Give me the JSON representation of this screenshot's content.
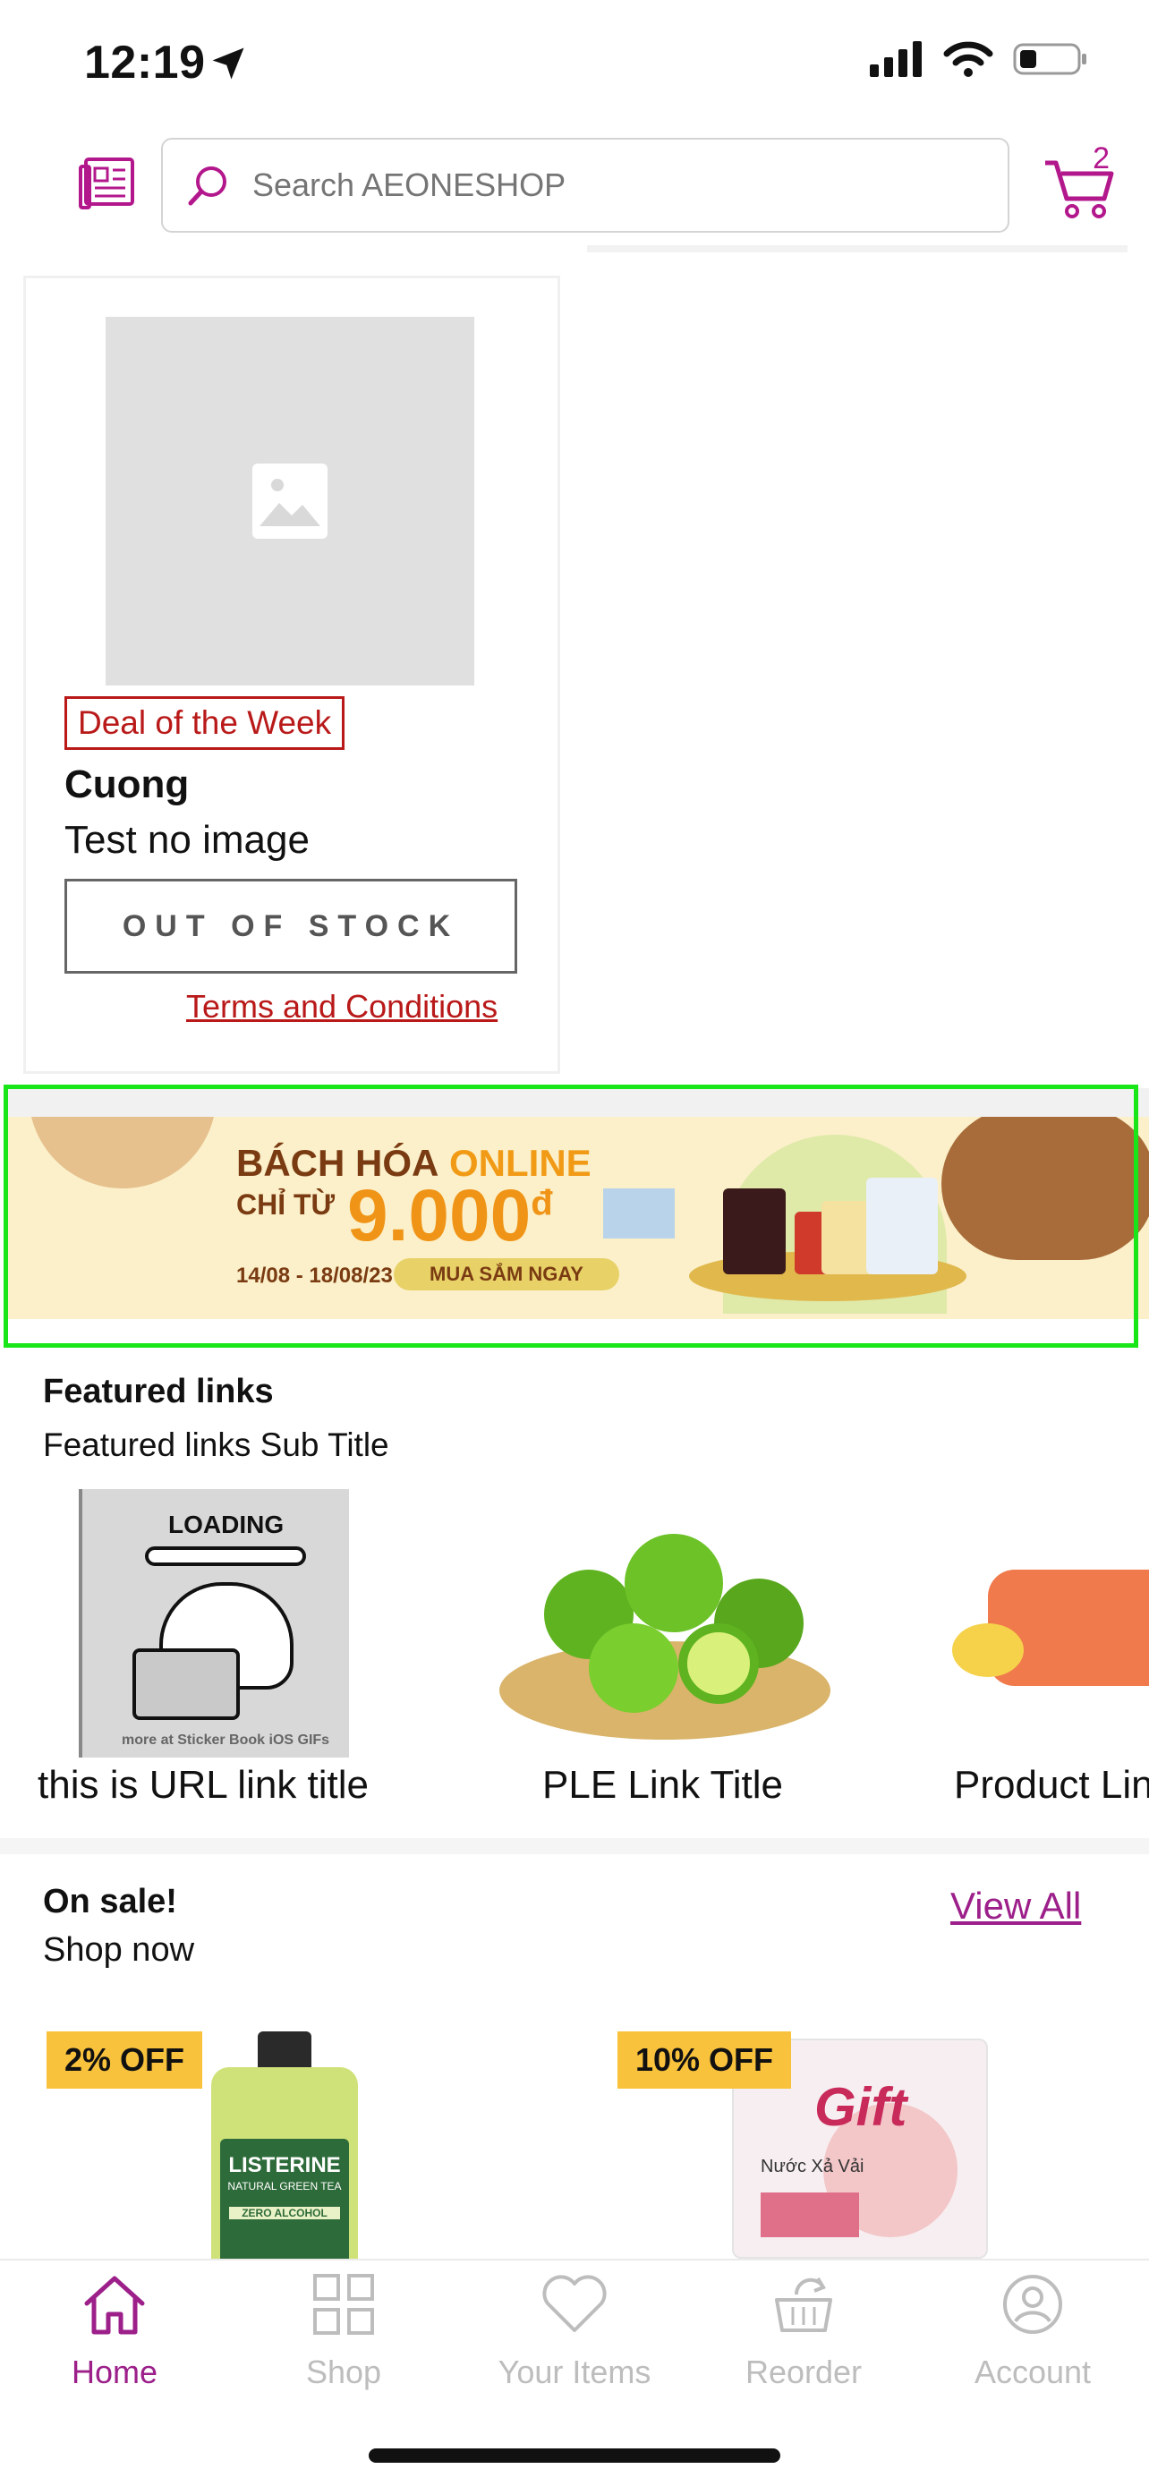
{
  "status_bar": {
    "time": "12:19"
  },
  "header": {
    "search_placeholder": "Search AEONESHOP",
    "cart_count": "2"
  },
  "deal": {
    "tag": "Deal of the Week",
    "brand": "Cuong",
    "name": "Test no image",
    "button": "OUT OF STOCK",
    "terms": "Terms and Conditions"
  },
  "banner": {
    "line1_a": "BÁCH HÓA",
    "line1_b": "ONLINE",
    "line2": "CHỈ TỪ",
    "price": "9.000",
    "currency": "đ",
    "dates": "14/08 - 18/08/23",
    "cta": "MUA SẮM NGAY"
  },
  "featured": {
    "title": "Featured links",
    "subtitle": "Featured links Sub Title",
    "items": [
      {
        "label": "this is URL link title",
        "loading": "LOADING",
        "credit": "more at Sticker Book iOS GIFs"
      },
      {
        "label": "PLE Link Title"
      },
      {
        "label": "Product Lin"
      }
    ]
  },
  "on_sale": {
    "title": "On sale!",
    "subtitle": "Shop now",
    "view_all": "View All",
    "products": [
      {
        "badge": "2% OFF",
        "brand_text": "LISTERINE",
        "sub_text": "NATURAL GREEN TEA",
        "variant": "ZERO ALCOHOL"
      },
      {
        "badge": "10% OFF",
        "brand_text": "Gift",
        "sub_text": "Nước Xả Vải"
      }
    ]
  },
  "tabs": [
    {
      "label": "Home",
      "active": true
    },
    {
      "label": "Shop",
      "active": false
    },
    {
      "label": "Your Items",
      "active": false
    },
    {
      "label": "Reorder",
      "active": false
    },
    {
      "label": "Account",
      "active": false
    }
  ],
  "colors": {
    "accent": "#9c1f8a",
    "deal_red": "#b91919",
    "badge_yellow": "#f9c23c",
    "highlight_green": "#19e619"
  }
}
